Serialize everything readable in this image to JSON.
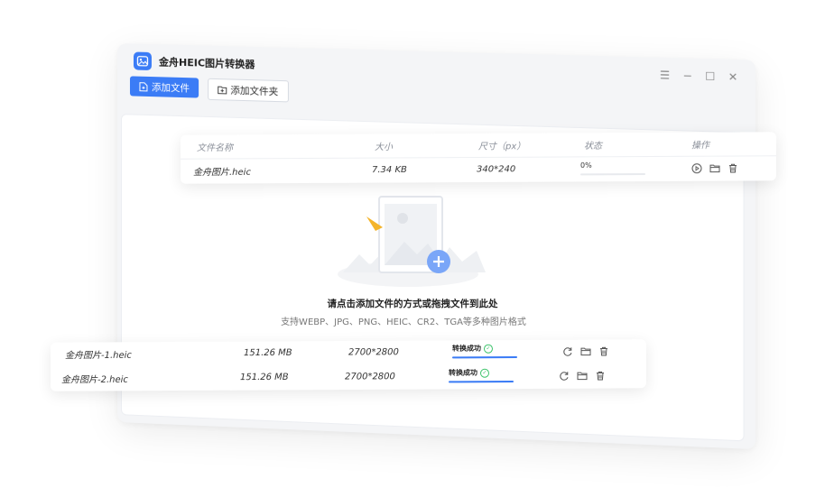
{
  "app": {
    "title": "金舟HEIC图片转换器"
  },
  "window_controls": {
    "menu": "☰",
    "minimize": "−",
    "maximize": "☐",
    "close": "✕"
  },
  "toolbar": {
    "add_file": "添加文件",
    "add_folder": "添加文件夹"
  },
  "table": {
    "headers": {
      "name": "文件名称",
      "size": "大小",
      "dimensions": "尺寸（px）",
      "status": "状态",
      "actions": "操作"
    },
    "pending_row": {
      "name": "金舟图片.heic",
      "size": "7.34 KB",
      "dimensions": "340*240",
      "progress_label": "0%",
      "progress": 0.0
    }
  },
  "empty_state": {
    "title": "请点击添加文件的方式或拖拽文件到此处",
    "subtitle": "支持WEBP、JPG、PNG、HEIC、CR2、TGA等多种图片格式"
  },
  "done_rows": [
    {
      "name": "金舟图片-1.heic",
      "size": "151.26 MB",
      "dimensions": "2700*2800",
      "status": "转换成功",
      "progress": 1.0
    },
    {
      "name": "金舟图片-2.heic",
      "size": "151.26 MB",
      "dimensions": "2700*2800",
      "status": "转换成功",
      "progress": 1.0
    }
  ],
  "colors": {
    "accent": "#3b7cf6",
    "success": "#3cc36a"
  }
}
